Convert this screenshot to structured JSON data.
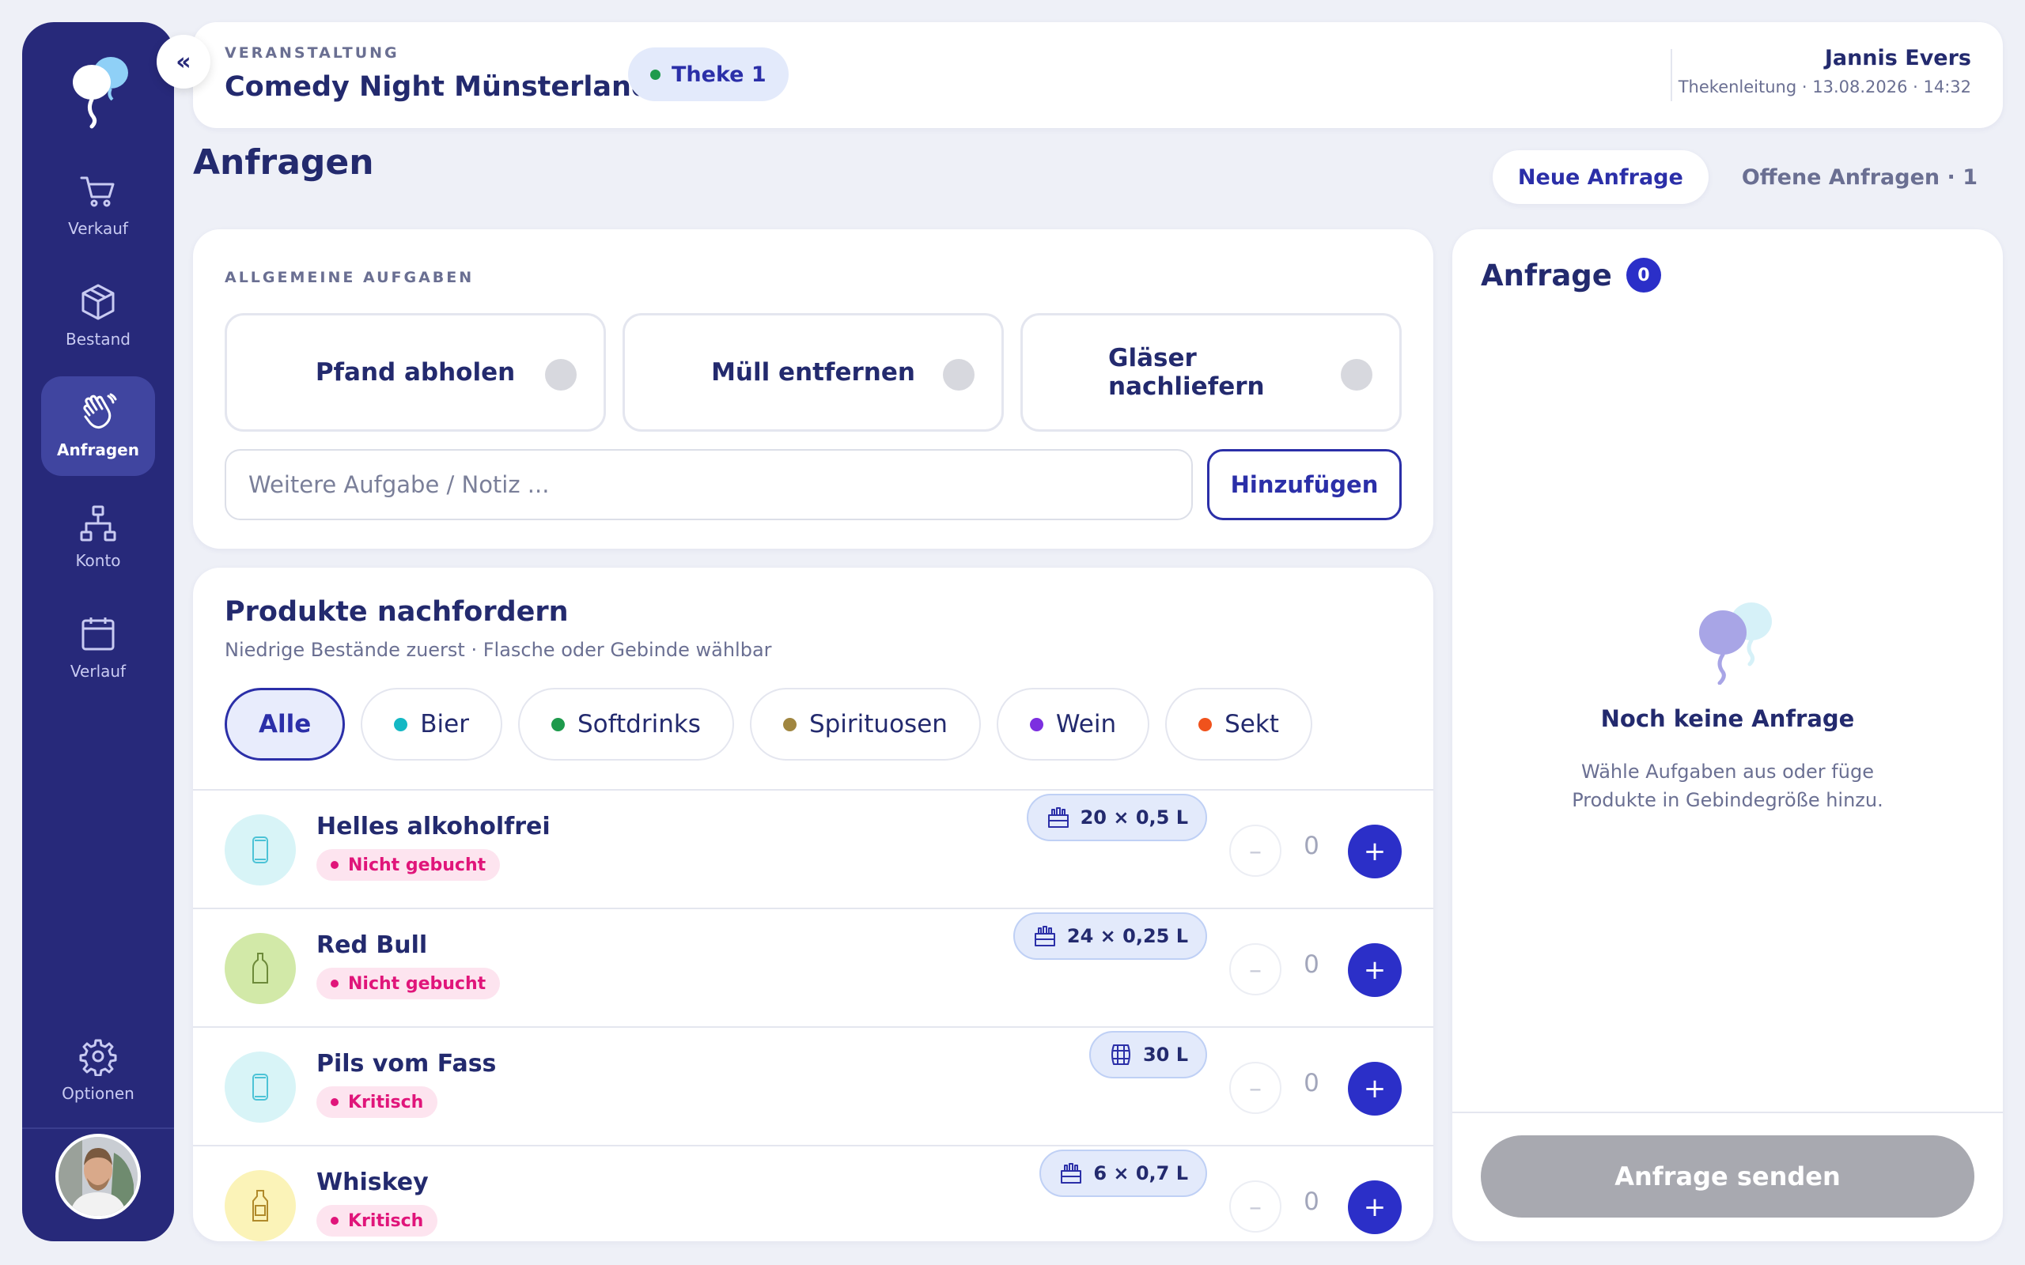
{
  "sidebar": {
    "collapse_label": "«",
    "items": [
      {
        "label": "Verkauf",
        "icon": "cart-icon"
      },
      {
        "label": "Bestand",
        "icon": "box-icon"
      },
      {
        "label": "Anfragen",
        "icon": "hand-wave-icon"
      },
      {
        "label": "Konto",
        "icon": "network-icon"
      },
      {
        "label": "Verlauf",
        "icon": "calendar-icon"
      }
    ],
    "options_label": "Optionen"
  },
  "header": {
    "kicker": "VERANSTALTUNG",
    "event_title": "Comedy Night Münsterland",
    "station_badge": "Theke 1",
    "user_name": "Jannis Evers",
    "user_meta": "Thekenleitung · 13.08.2026 · 14:32"
  },
  "page": {
    "title": "Anfragen",
    "tabs": [
      {
        "label": "Neue Anfrage",
        "active": true
      },
      {
        "label": "Offene Anfragen · 1",
        "active": false
      }
    ]
  },
  "tasks": {
    "kicker": "ALLGEMEINE AUFGABEN",
    "items": [
      {
        "label": "Pfand abholen"
      },
      {
        "label": "Müll entfernen"
      },
      {
        "label": "Gläser nachliefern"
      }
    ],
    "note_placeholder": "Weitere Aufgabe / Notiz ...",
    "add_label": "Hinzufügen"
  },
  "products": {
    "title": "Produkte nachfordern",
    "subtitle": "Niedrige Bestände zuerst · Flasche oder Gebinde wählbar",
    "filters": [
      {
        "label": "Alle",
        "color": null
      },
      {
        "label": "Bier",
        "color": "#14b8c4"
      },
      {
        "label": "Softdrinks",
        "color": "#1e9a4c"
      },
      {
        "label": "Spirituosen",
        "color": "#a08640"
      },
      {
        "label": "Wein",
        "color": "#7c2fe0"
      },
      {
        "label": "Sekt",
        "color": "#f0521c"
      }
    ],
    "items": [
      {
        "name": "Helles alkoholfrei",
        "status": "Nicht gebucht",
        "unit": "20 × 0,5 L",
        "unit_icon": "crate-icon",
        "qty": "0",
        "icon": "can-icon",
        "icon_bg": "#d8f4f7"
      },
      {
        "name": "Red Bull",
        "status": "Nicht gebucht",
        "unit": "24 × 0,25 L",
        "unit_icon": "crate-icon",
        "qty": "0",
        "icon": "bottle-icon",
        "icon_bg": "#d2e9a8"
      },
      {
        "name": "Pils vom Fass",
        "status": "Kritisch",
        "unit": "30 L",
        "unit_icon": "keg-icon",
        "qty": "0",
        "icon": "can-icon",
        "icon_bg": "#d8f4f7"
      },
      {
        "name": "Whiskey",
        "status": "Kritisch",
        "unit": "6 × 0,7 L",
        "unit_icon": "crate-icon",
        "qty": "0",
        "icon": "liquor-bottle-icon",
        "icon_bg": "#fbf3b8"
      }
    ]
  },
  "request": {
    "title": "Anfrage",
    "count": "0",
    "empty_title": "Noch keine Anfrage",
    "empty_text": "Wähle Aufgaben aus oder füge Produkte in Gebindegröße hinzu.",
    "send_label": "Anfrage senden"
  }
}
